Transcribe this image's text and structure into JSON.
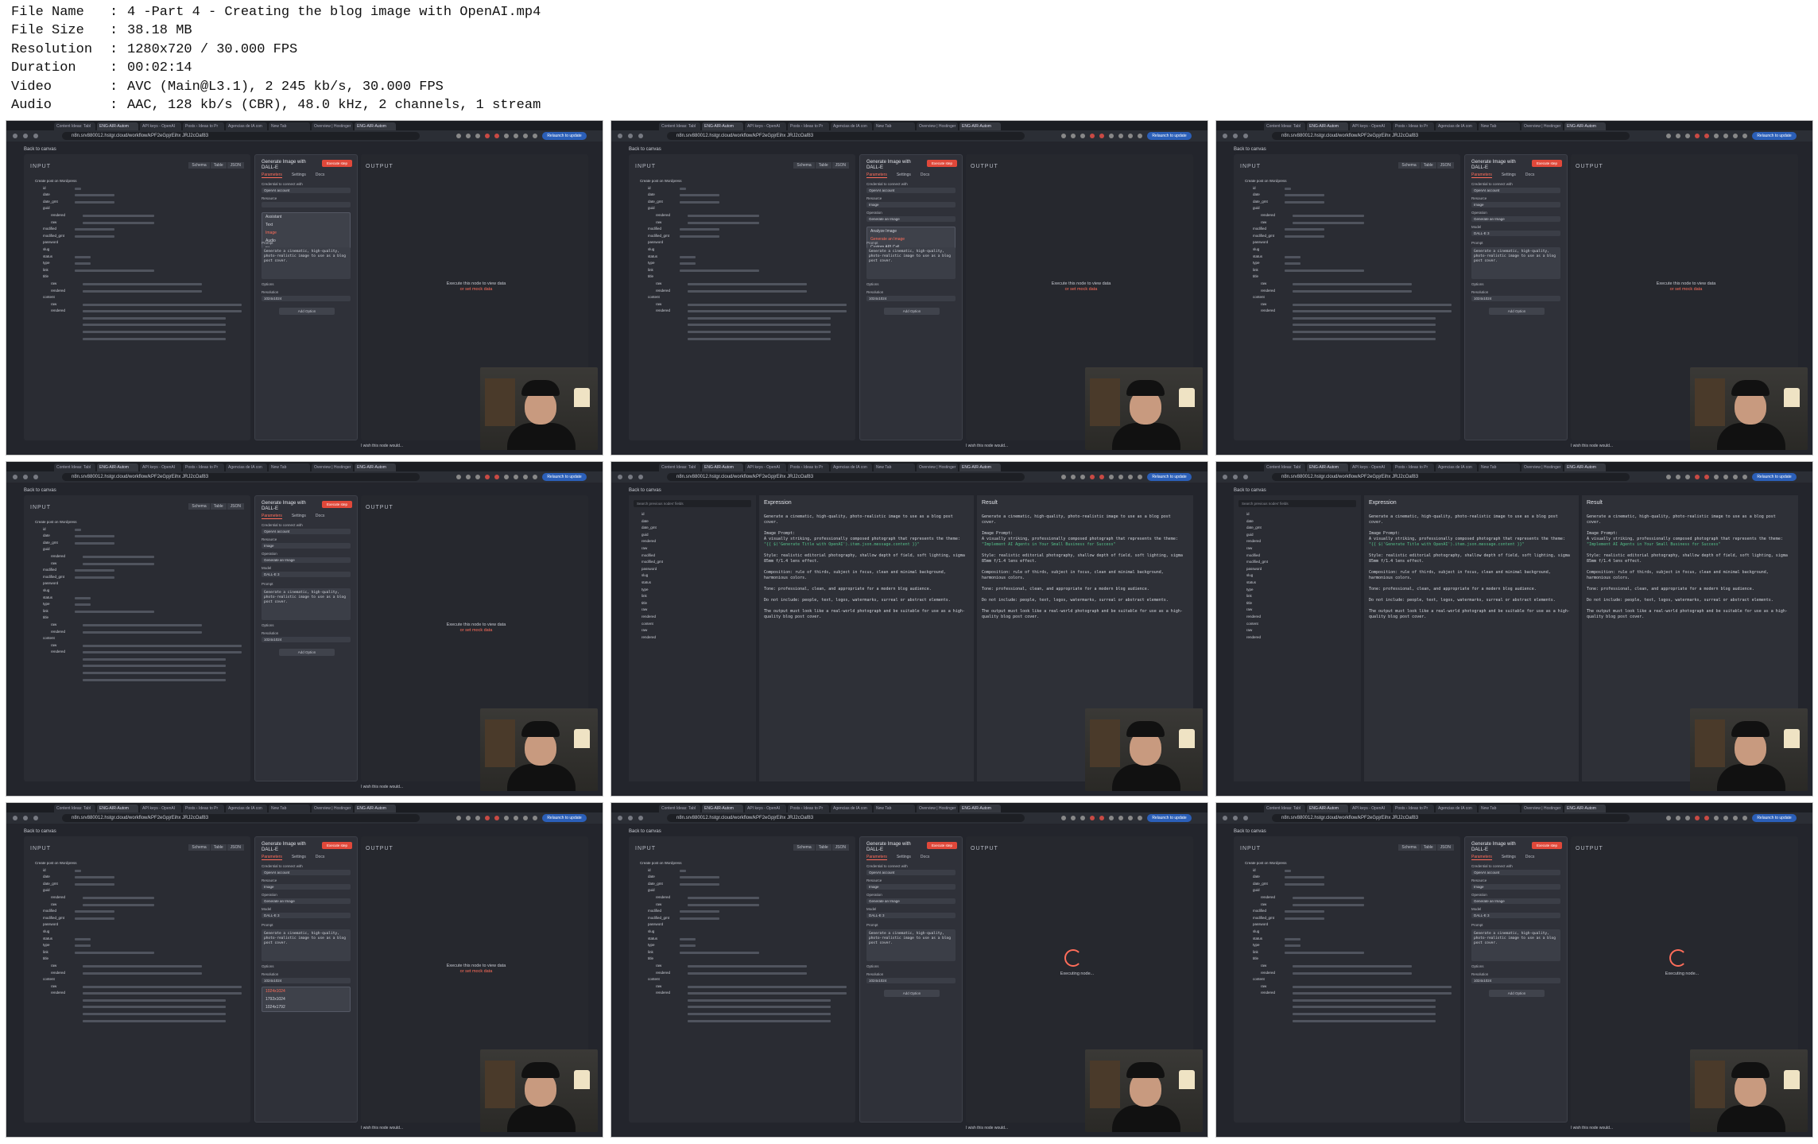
{
  "meta": [
    {
      "key": "File Name",
      "value": "4 -Part 4 - Creating the blog image with OpenAI.mp4"
    },
    {
      "key": "File Size",
      "value": "38.18 MB"
    },
    {
      "key": "Resolution",
      "value": "1280x720 / 30.000 FPS"
    },
    {
      "key": "Duration",
      "value": "00:02:14"
    },
    {
      "key": "Video",
      "value": "AVC (Main@L3.1), 2 245 kb/s, 30.000 FPS"
    },
    {
      "key": "Audio",
      "value": "AAC, 128 kb/s (CBR), 48.0 kHz, 2 channels, 1 stream"
    }
  ],
  "browser": {
    "tabs": [
      "Content Ideas: Tabl",
      "ENG-AIR-Autom",
      "API keys - OpenAI",
      "Posts ‹ Ideas to Pr",
      "Agencias de IA con",
      "New Tab",
      "Overview | Hostinger",
      "ENG-AIR-Autom"
    ],
    "url": "n8n.srv880012.hstgr.cloud/workflow/kPF2eGpjrEihx JRJ2cOaf83",
    "relaunch_label": "Relaunch to update"
  },
  "editor": {
    "back_label": "Back to canvas",
    "input_title": "INPUT",
    "view_modes": [
      "Schema",
      "Table",
      "JSON"
    ],
    "node_title": "Generate Image with DALL-E",
    "execute_label": "Execute step",
    "node_tabs": [
      "Parameters",
      "Settings",
      "Docs"
    ],
    "labels": {
      "credential": "Credential to connect with",
      "credential_value": "OpenAI account",
      "resource": "Resource",
      "resource_value": "Image",
      "operation": "Operation",
      "operation_value": "Generate an Image",
      "model": "Model",
      "model_value": "DALL-E 3",
      "prompt": "Prompt",
      "options": "Options",
      "resolution": "Resolution",
      "resolution_value": "1024x1024",
      "add_option": "Add Option"
    },
    "resource_options": [
      "Assistant",
      "Text",
      "Image",
      "Audio",
      "File",
      "Custom API Call"
    ],
    "operation_options": [
      "Analyze Image",
      "Generate an Image",
      "Custom API Call"
    ],
    "resolution_options": [
      "1024x1024",
      "1792x1024",
      "1024x1792"
    ],
    "output_title": "OUTPUT",
    "output_msg_1": "Execute this node to view data",
    "output_msg_2": "or set mock data",
    "executing_msg": "Executing node...",
    "wish_msg": "I wish this node would...",
    "prompt_preview": "Generate a cinematic, high-quality, photo-realistic image to use as a blog post cover.",
    "tree_root": "Create post on Wordpress",
    "tree_keys": [
      "id",
      "date",
      "date_gmt",
      "guid",
      "rendered",
      "raw",
      "modified",
      "modified_gmt",
      "password",
      "slug",
      "status",
      "type",
      "link",
      "title",
      "raw",
      "rendered",
      "content",
      "raw",
      "rendered"
    ]
  },
  "expression": {
    "search_placeholder": "Search previous nodes' fields",
    "expression_title": "Expression",
    "result_title": "Result",
    "lines": [
      "Generate a cinematic, high-quality, photo-realistic image to use as a blog post cover.",
      "",
      "Image Prompt:",
      "A visually striking, professionally composed photograph that represents the theme:",
      "\"{{ $('Generate Title with OpenAI').item.json.message.content }}\"",
      "",
      "Style: realistic editorial photography, shallow depth of field, soft lighting, sigma 85mm f/1.4 lens effect.",
      "",
      "Composition: rule of thirds, subject in focus, clean and minimal background, harmonious colors.",
      "",
      "Tone: professional, clean, and appropriate for a modern blog audience.",
      "",
      "Do not include: people, text, logos, watermarks, surreal or abstract elements.",
      "",
      "The output must look like a real-world photograph and be suitable for use as a high-quality blog post cover."
    ],
    "result_title_line": "\"Implement AI Agents in Your Small Business for Success\""
  }
}
